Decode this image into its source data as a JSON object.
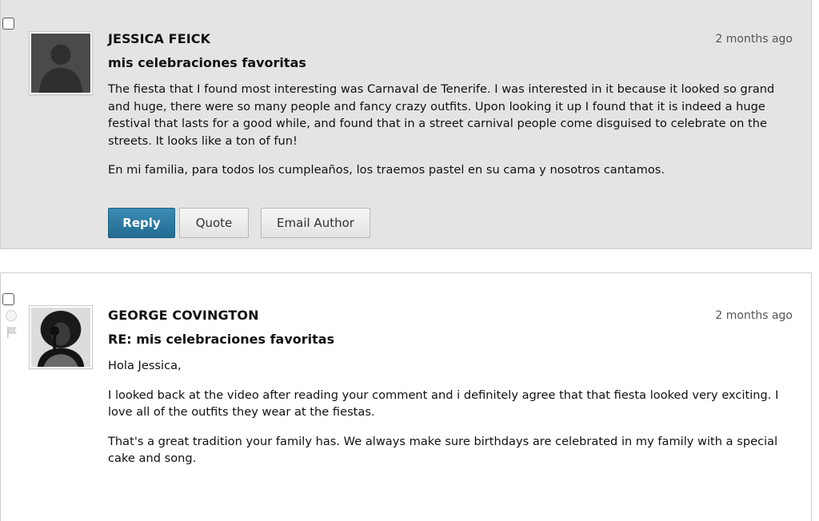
{
  "posts": [
    {
      "author": "JESSICA FEICK",
      "timestamp": "2 months ago",
      "subject": "mis celebraciones favoritas",
      "paragraphs": [
        "The fiesta that I found most interesting was Carnaval de Tenerife. I was interested in it because it looked so grand and huge, there were so many people and fancy crazy outfits. Upon looking it up I found that it is indeed a huge festival that lasts for a good while, and found that in a street carnival people come disguised to celebrate on the streets. It looks like a ton of fun!",
        "En mi familia, para todos los cumpleaños, los traemos pastel en su cama y nosotros cantamos."
      ],
      "actions": {
        "reply": "Reply",
        "quote": "Quote",
        "email": "Email Author"
      }
    },
    {
      "author": "GEORGE COVINGTON",
      "timestamp": "2 months ago",
      "subject": "RE: mis celebraciones favoritas",
      "paragraphs": [
        "Hola Jessica,",
        "I looked back at the video after reading your comment and i definitely agree that that fiesta looked very exciting. I love all of the outfits they wear at the fiestas.",
        "That's a great tradition your family has. We always make sure birthdays are celebrated in my family with a special cake and song."
      ]
    }
  ],
  "colors": {
    "selected_post_bg": "#e4e4e4",
    "reply_button": "#2a7aa3"
  },
  "icons": [
    "default-avatar-icon",
    "user-photo-avatar",
    "status-circle-icon",
    "flag-icon"
  ]
}
